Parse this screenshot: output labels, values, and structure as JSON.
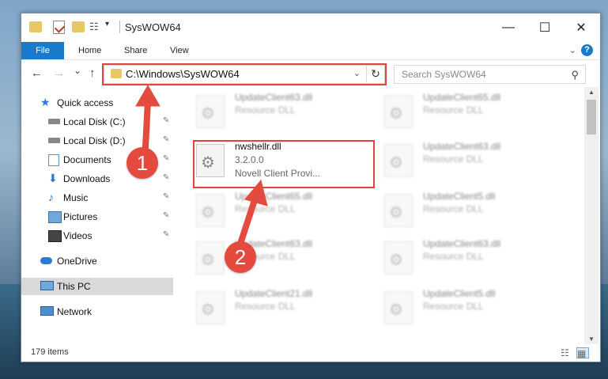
{
  "window": {
    "title": "SysWOW64",
    "minimize_glyph": "—",
    "maximize_glyph": "☐",
    "close_glyph": "✕"
  },
  "ribbon": {
    "tabs": [
      "File",
      "Home",
      "Share",
      "View"
    ],
    "help": "?"
  },
  "nav": {
    "back": "←",
    "forward": "→",
    "recent": "⌄",
    "up": "↑",
    "address": "C:\\Windows\\SysWOW64",
    "refresh": "↻",
    "search_placeholder": "Search SysWOW64",
    "search_icon": "⚲"
  },
  "sidebar": {
    "items": [
      {
        "label": "Quick access",
        "icon": "star-icon",
        "pinned": false
      },
      {
        "label": "Local Disk (C:)",
        "icon": "drive-icon",
        "pinned": true
      },
      {
        "label": "Local Disk (D:)",
        "icon": "drive-icon",
        "pinned": true
      },
      {
        "label": "Documents",
        "icon": "documents-icon",
        "pinned": true
      },
      {
        "label": "Downloads",
        "icon": "downloads-icon",
        "pinned": true
      },
      {
        "label": "Music",
        "icon": "music-icon",
        "pinned": true
      },
      {
        "label": "Pictures",
        "icon": "pictures-icon",
        "pinned": true
      },
      {
        "label": "Videos",
        "icon": "videos-icon",
        "pinned": true
      },
      {
        "label": "OneDrive",
        "icon": "cloud-icon",
        "pinned": false
      },
      {
        "label": "This PC",
        "icon": "pc-icon",
        "pinned": false
      },
      {
        "label": "Network",
        "icon": "network-icon",
        "pinned": false
      }
    ],
    "pin_glyph": "📌"
  },
  "files": {
    "highlighted": {
      "name": "nwshellr.dll",
      "version": "3.2.0.0",
      "description": "Novell Client Provi..."
    },
    "left_column": [
      {
        "name": "UpdateClient63.dll",
        "sub": "Resource DLL"
      },
      {
        "name": "UpdateClient65.dll",
        "sub": "Resource DLL"
      },
      {
        "name": "UpdateClient63.dll",
        "sub": "Resource DLL"
      },
      {
        "name": "UpdateClient21.dll",
        "sub": "Resource DLL"
      }
    ],
    "right_column": [
      {
        "name": "UpdateClient65.dll",
        "sub": "Resource DLL"
      },
      {
        "name": "UpdateClient63.dll",
        "sub": "Resource DLL"
      },
      {
        "name": "UpdateClient5.dll",
        "sub": "Resource DLL"
      },
      {
        "name": "UpdateClient63.dll",
        "sub": "Resource DLL"
      },
      {
        "name": "UpdateClient5.dll",
        "sub": "Resource DLL"
      }
    ]
  },
  "status": {
    "item_count": "179 items"
  },
  "annotations": {
    "step1": "1",
    "step2": "2",
    "color": "#e44a3d"
  }
}
